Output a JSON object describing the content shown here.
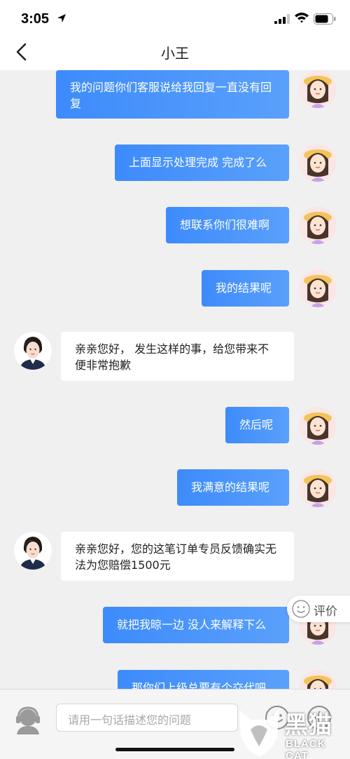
{
  "status_bar": {
    "time": "3:05"
  },
  "nav": {
    "title": "小王"
  },
  "messages": [
    {
      "sender": "user",
      "text": "我的问题你们客服说给我回复一直没有回复"
    },
    {
      "sender": "user",
      "text": "上面显示处理完成 完成了么"
    },
    {
      "sender": "user",
      "text": "想联系你们很难啊"
    },
    {
      "sender": "user",
      "text": "我的结果呢"
    },
    {
      "sender": "agent",
      "text": "亲亲您好， 发生这样的事，给您带来不便非常抱歉"
    },
    {
      "sender": "user",
      "text": "然后呢"
    },
    {
      "sender": "user",
      "text": "我满意的结果呢"
    },
    {
      "sender": "agent",
      "text": "亲亲您好，您的这笔订单专员反馈确实无法为您赔偿1500元"
    },
    {
      "sender": "user",
      "text": "就把我晾一边 没人来解释下么"
    },
    {
      "sender": "user",
      "text": "那你们上级总要有个交代吧"
    }
  ],
  "rate_button": {
    "label": "评价"
  },
  "input": {
    "placeholder": "请用一句话描述您的问题"
  },
  "watermark": {
    "cn": "黑猫",
    "en": "BLACK CAT"
  },
  "colors": {
    "user_bubble": "#3d8bfb",
    "agent_bubble": "#ffffff",
    "chat_bg": "#f0f0f0"
  },
  "icons": {
    "back": "chevron-left-icon",
    "rate": "smiley-icon",
    "service": "customer-service-icon",
    "emoji": "emoji-icon",
    "plus": "plus-icon"
  }
}
